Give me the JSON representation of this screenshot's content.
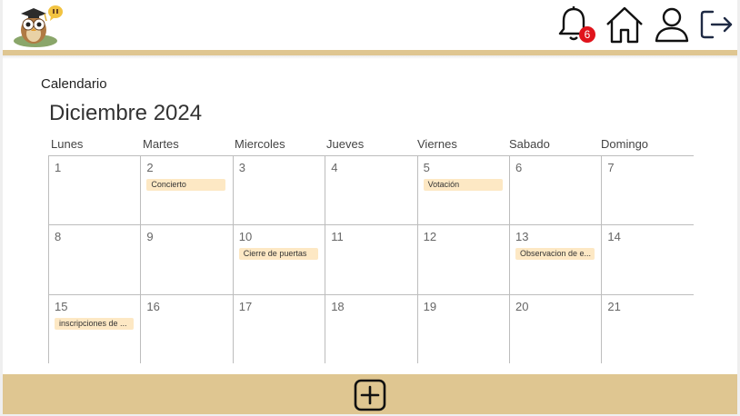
{
  "header": {
    "logo_icon": "owl-graduate-icon",
    "notifications_count": "6",
    "icons": [
      "bell-icon",
      "home-icon",
      "user-icon",
      "logout-icon"
    ]
  },
  "section_title": "Calendario",
  "month_title": "Diciembre 2024",
  "weekdays": [
    "Lunes",
    "Martes",
    "Miercoles",
    "Jueves",
    "Viernes",
    "Sabado",
    "Domingo"
  ],
  "days": [
    {
      "num": "1",
      "event": ""
    },
    {
      "num": "2",
      "event": "Concierto"
    },
    {
      "num": "3",
      "event": ""
    },
    {
      "num": "4",
      "event": ""
    },
    {
      "num": "5",
      "event": "Votación"
    },
    {
      "num": "6",
      "event": ""
    },
    {
      "num": "7",
      "event": ""
    },
    {
      "num": "8",
      "event": ""
    },
    {
      "num": "9",
      "event": ""
    },
    {
      "num": "10",
      "event": "Cierre de puertas"
    },
    {
      "num": "11",
      "event": ""
    },
    {
      "num": "12",
      "event": ""
    },
    {
      "num": "13",
      "event": "Observacion de e..."
    },
    {
      "num": "14",
      "event": ""
    },
    {
      "num": "15",
      "event": "inscripciones de ..."
    },
    {
      "num": "16",
      "event": ""
    },
    {
      "num": "17",
      "event": ""
    },
    {
      "num": "18",
      "event": ""
    },
    {
      "num": "19",
      "event": ""
    },
    {
      "num": "20",
      "event": ""
    },
    {
      "num": "21",
      "event": ""
    }
  ],
  "footer": {
    "add_icon": "plus-square-icon"
  },
  "colors": {
    "accent": "#dfc691",
    "event_bg": "#fde8c4",
    "badge": "#e0141c"
  }
}
